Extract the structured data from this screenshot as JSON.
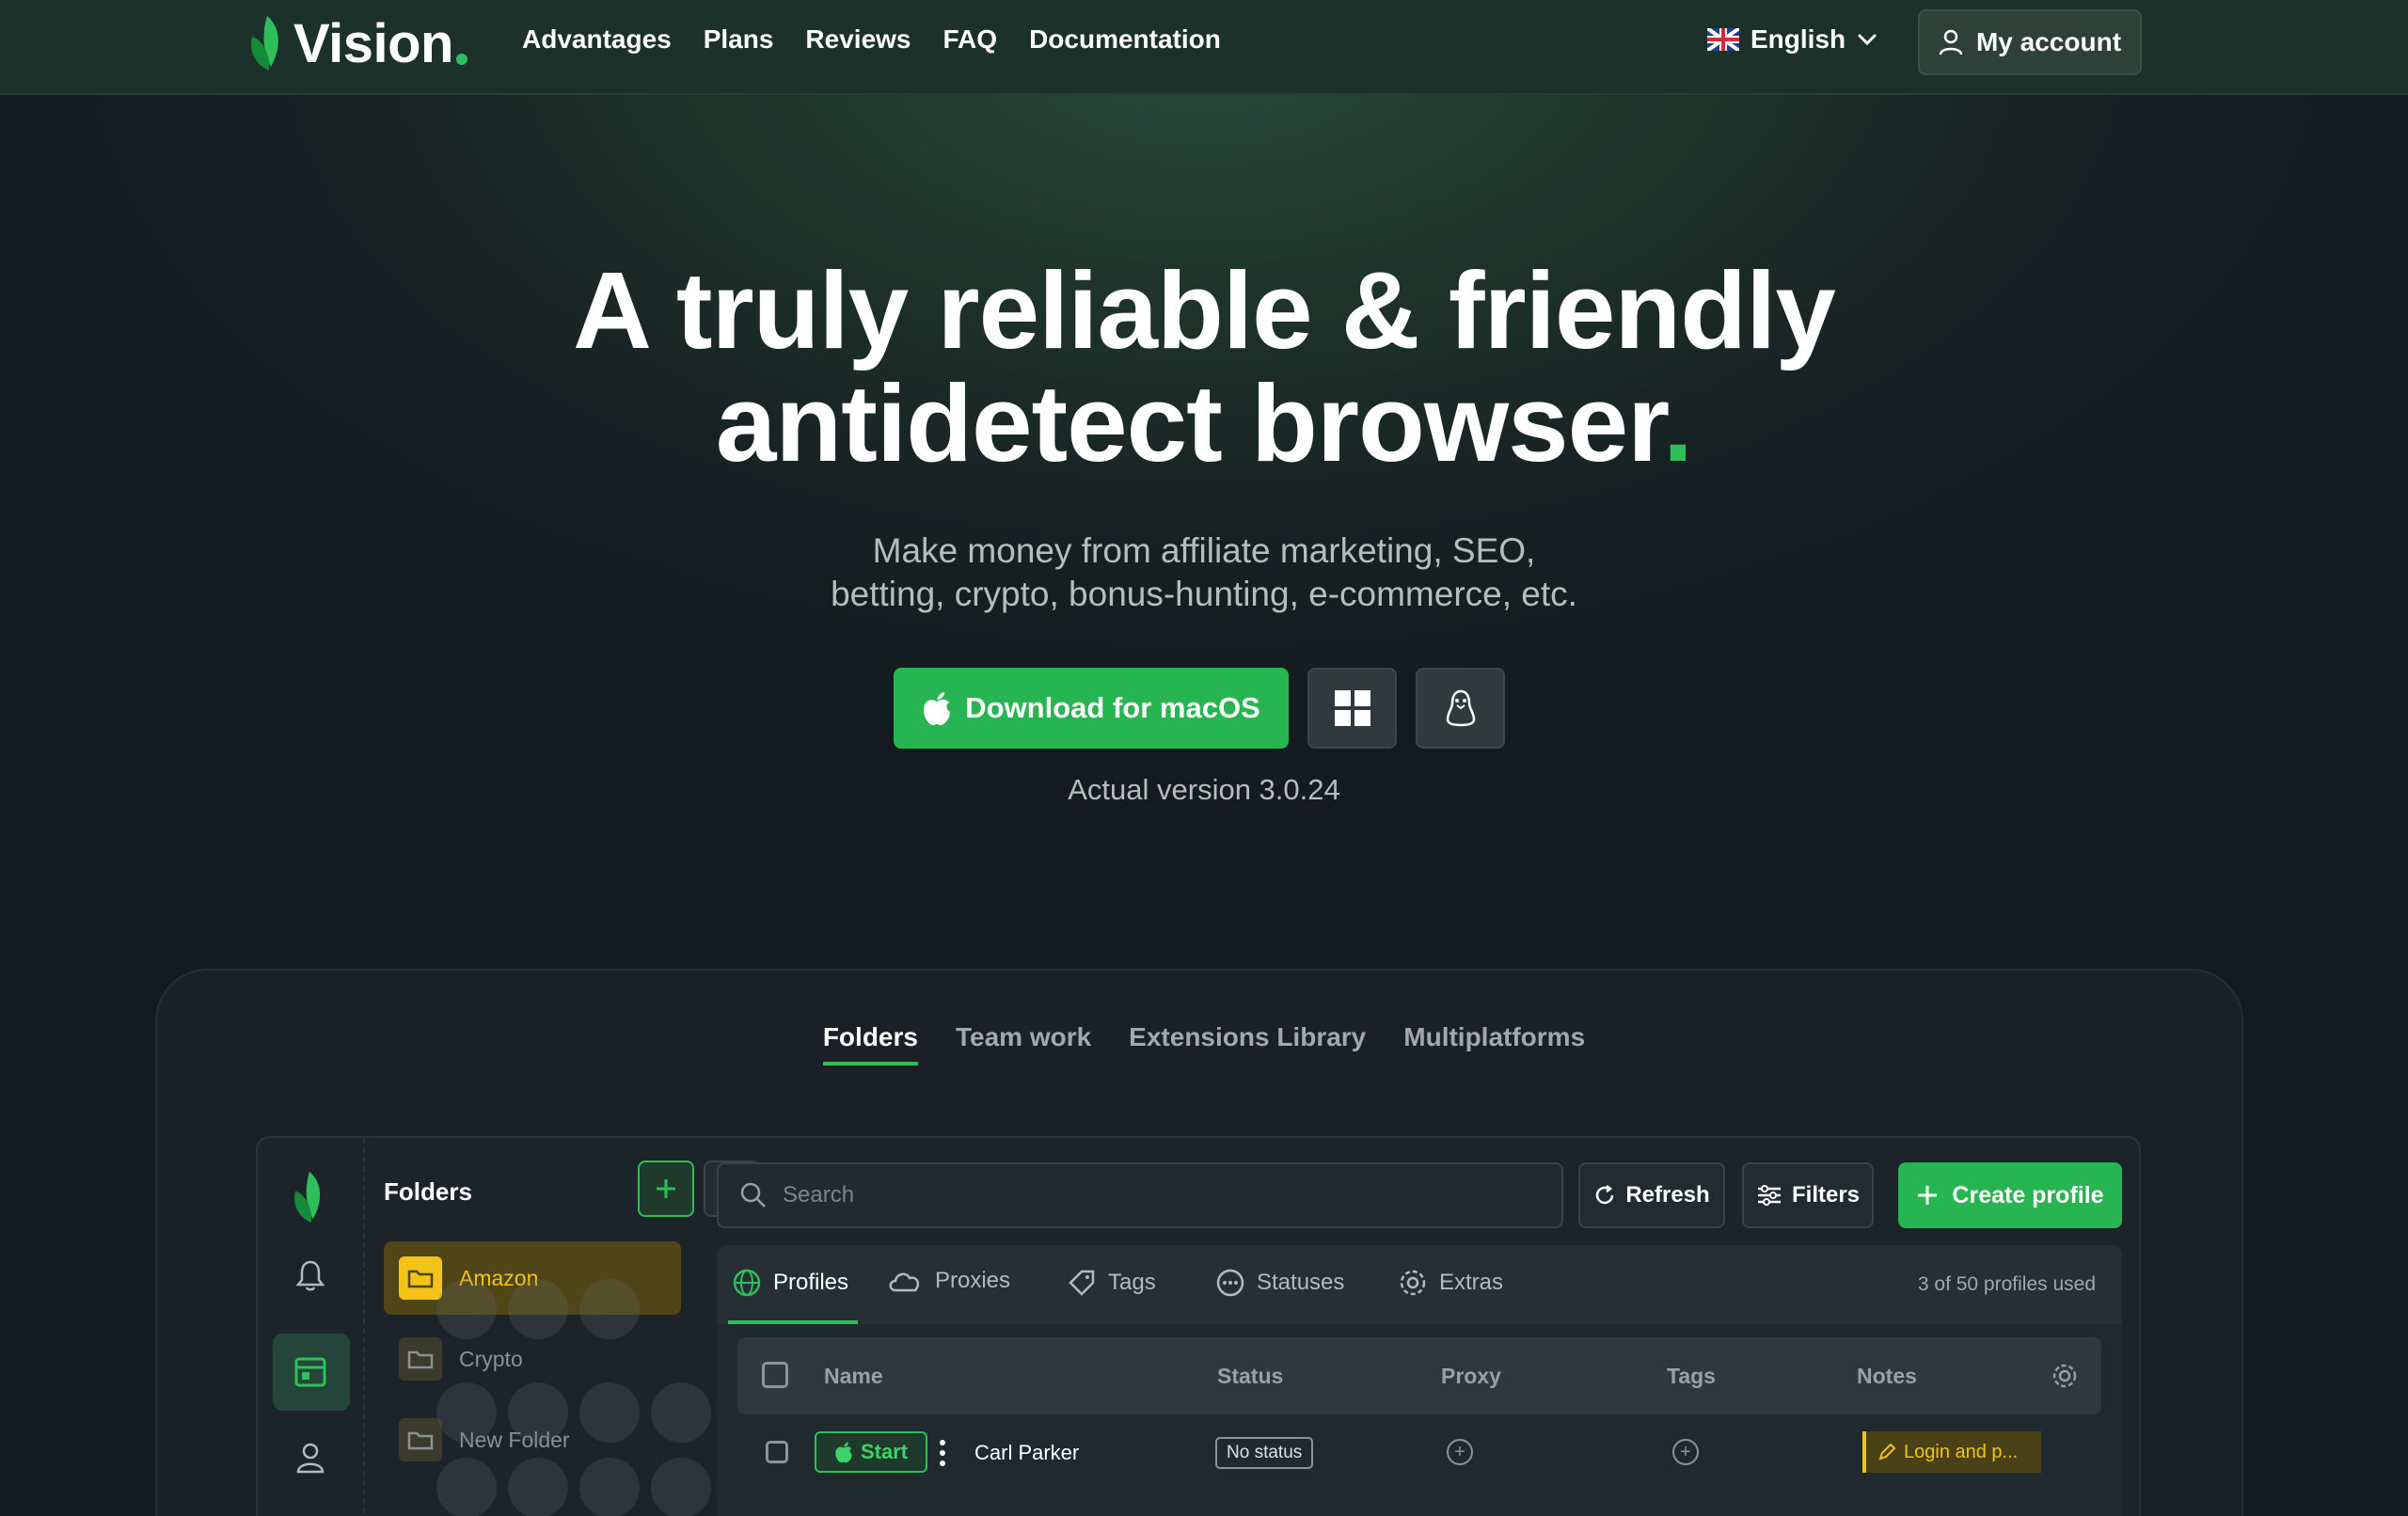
{
  "nav": {
    "logo_text": "Vision",
    "links": [
      "Advantages",
      "Plans",
      "Reviews",
      "FAQ",
      "Documentation"
    ],
    "language": "English",
    "account_label": "My account"
  },
  "hero": {
    "title_line1": "A truly reliable & friendly",
    "title_line2": "antidetect browser",
    "title_dot": ".",
    "subtitle_line1": "Make money from affiliate marketing, SEO,",
    "subtitle_line2": "betting, crypto, bonus-hunting, e-commerce, etc.",
    "download_label": "Download for macOS",
    "version": "Actual version 3.0.24"
  },
  "demo": {
    "tabs": [
      "Folders",
      "Team work",
      "Extensions Library",
      "Multiplatforms"
    ],
    "active_tab": "Folders",
    "folders_title": "Folders",
    "folders": [
      "Amazon",
      "Crypto",
      "New Folder"
    ],
    "search_placeholder": "Search",
    "refresh_label": "Refresh",
    "filters_label": "Filters",
    "create_label": "Create profile",
    "subtabs": [
      "Profiles",
      "Proxies",
      "Tags",
      "Statuses",
      "Extras"
    ],
    "usage": "3 of 50 profiles used",
    "columns": [
      "Name",
      "Status",
      "Proxy",
      "Tags",
      "Notes"
    ],
    "row": {
      "start_label": "Start",
      "name": "Carl Parker",
      "status": "No status",
      "note": "Login and p..."
    }
  },
  "colors": {
    "accent": "#27b552",
    "folder_accent": "#f2c417",
    "background": "#141a1f"
  }
}
